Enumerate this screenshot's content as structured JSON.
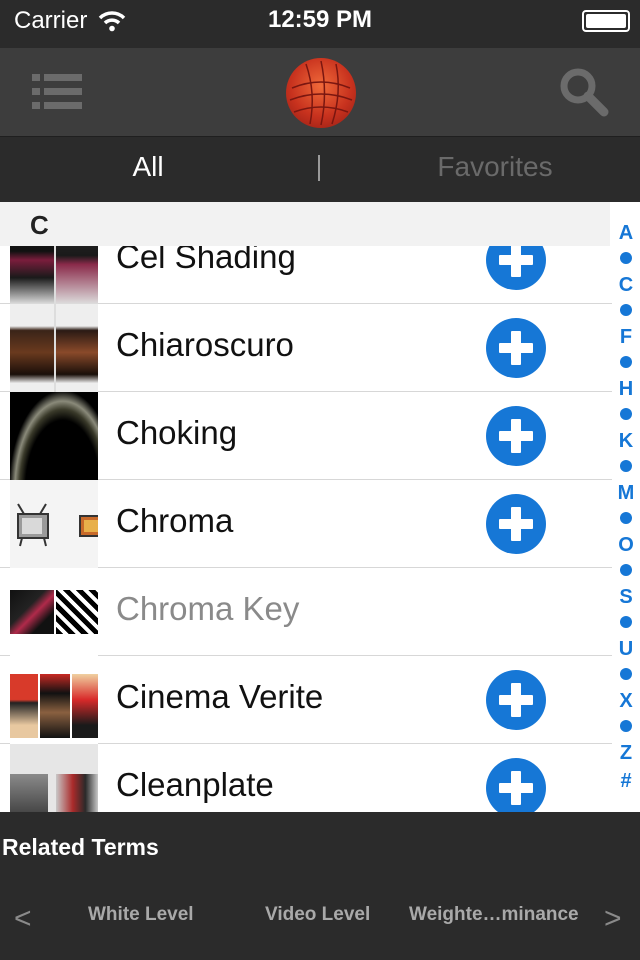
{
  "status_bar": {
    "carrier": "Carrier",
    "time": "12:59 PM"
  },
  "nav": {
    "menu_icon": "list-icon",
    "logo_icon": "globe-logo-icon",
    "search_icon": "search-icon"
  },
  "tabs": {
    "all": "All",
    "separator": "|",
    "favorites": "Favorites"
  },
  "list": {
    "section": "C",
    "rows": [
      {
        "title": "Cel Shading",
        "has_add": true
      },
      {
        "title": "Chiaroscuro",
        "has_add": true
      },
      {
        "title": "Choking",
        "has_add": true
      },
      {
        "title": "Chroma",
        "has_add": true
      },
      {
        "title": "Chroma Key",
        "has_add": false
      },
      {
        "title": "Cinema Verite",
        "has_add": true
      },
      {
        "title": "Cleanplate",
        "has_add": true
      }
    ]
  },
  "index": [
    "A",
    "•",
    "C",
    "•",
    "F",
    "•",
    "H",
    "•",
    "K",
    "•",
    "M",
    "•",
    "O",
    "•",
    "S",
    "•",
    "U",
    "•",
    "X",
    "•",
    "Z",
    "#"
  ],
  "related": {
    "title": "Related Terms",
    "prev": "<",
    "next": ">",
    "items": [
      "White Level",
      "Video Level",
      "Weighte…minance"
    ]
  },
  "colors": {
    "accent": "#1677d6",
    "bar_dark": "#2b2b2b",
    "nav_bar": "#3d3d3d"
  }
}
